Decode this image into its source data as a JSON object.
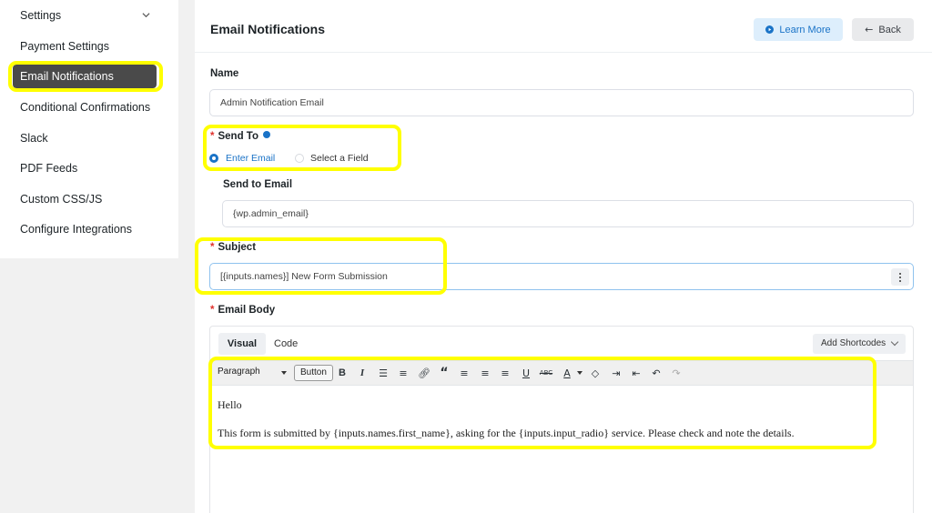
{
  "sidebar": {
    "settings_label": "Settings",
    "items": [
      {
        "label": "Payment Settings"
      },
      {
        "label": "Email Notifications"
      },
      {
        "label": "Conditional Confirmations"
      },
      {
        "label": "Slack"
      },
      {
        "label": "PDF Feeds"
      },
      {
        "label": "Custom CSS/JS"
      },
      {
        "label": "Configure Integrations"
      }
    ]
  },
  "header": {
    "title": "Email Notifications",
    "learn_more": "Learn More",
    "back": "Back"
  },
  "form": {
    "name_label": "Name",
    "name_value": "Admin Notification Email",
    "send_to_label": "Send To",
    "send_to_options": [
      "Enter Email",
      "Select a Field"
    ],
    "send_to_selected": "Enter Email",
    "send_to_email_label": "Send to Email",
    "send_to_email_value": "{wp.admin_email}",
    "subject_label": "Subject",
    "subject_value": "[{inputs.names}] New Form Submission",
    "email_body_label": "Email Body"
  },
  "editor": {
    "tabs": [
      "Visual",
      "Code"
    ],
    "active_tab": "Visual",
    "add_shortcodes": "Add Shortcodes",
    "format_select": "Paragraph",
    "button_label": "Button",
    "toolbar_icons": [
      "bold-icon",
      "italic-icon",
      "bullet-list-icon",
      "numbered-list-icon",
      "link-icon",
      "blockquote-icon",
      "align-left-icon",
      "align-center-icon",
      "align-right-icon",
      "underline-icon",
      "strikethrough-icon",
      "text-color-icon",
      "clear-formatting-icon",
      "indent-icon",
      "outdent-icon",
      "undo-icon",
      "redo-icon"
    ],
    "content": {
      "line1": "Hello",
      "line2": "This form is submitted by {inputs.names.first_name}, asking for the {inputs.input_radio} service. Please check and note the details."
    }
  },
  "colors": {
    "accent": "#1a73c7",
    "highlight": "#ffff00",
    "required": "#e0312c",
    "active_sidebar": "#4a4a4a"
  }
}
